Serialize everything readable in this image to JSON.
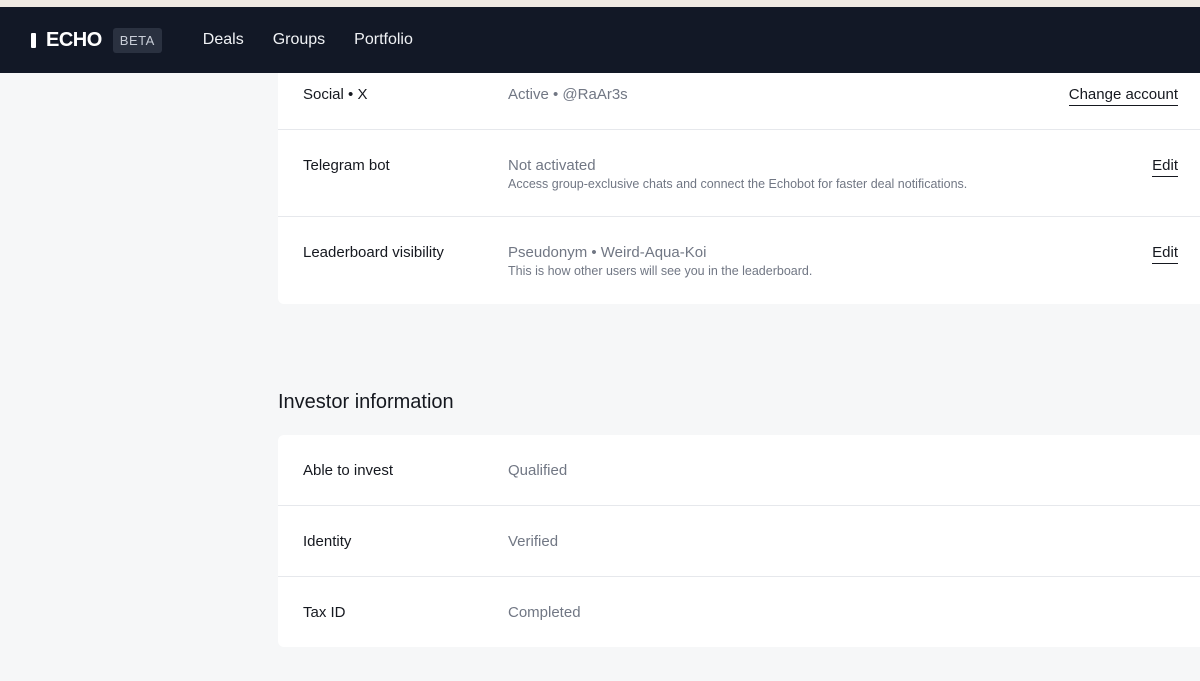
{
  "navbar": {
    "logo_text": "ECHO",
    "badge": "BETA",
    "links": [
      "Deals",
      "Groups",
      "Portfolio"
    ]
  },
  "social_section": {
    "rows": [
      {
        "label": "Social • X",
        "value": "Active • @RaAr3s",
        "sub": "",
        "action": "Change account"
      },
      {
        "label": "Telegram bot",
        "value": "Not activated",
        "sub": "Access group-exclusive chats and connect the Echobot for faster deal notifications.",
        "action": "Edit"
      },
      {
        "label": "Leaderboard visibility",
        "value": "Pseudonym • Weird-Aqua-Koi",
        "sub": "This is how other users will see you in the leaderboard.",
        "action": "Edit"
      }
    ]
  },
  "investor_section": {
    "title": "Investor information",
    "rows": [
      {
        "label": "Able to invest",
        "value": "Qualified"
      },
      {
        "label": "Identity",
        "value": "Verified"
      },
      {
        "label": "Tax ID",
        "value": "Completed"
      }
    ]
  },
  "colors": {
    "navbar_bg": "#121826",
    "page_bg": "#f6f7f8",
    "card_bg": "#ffffff",
    "muted_text": "#717784"
  }
}
